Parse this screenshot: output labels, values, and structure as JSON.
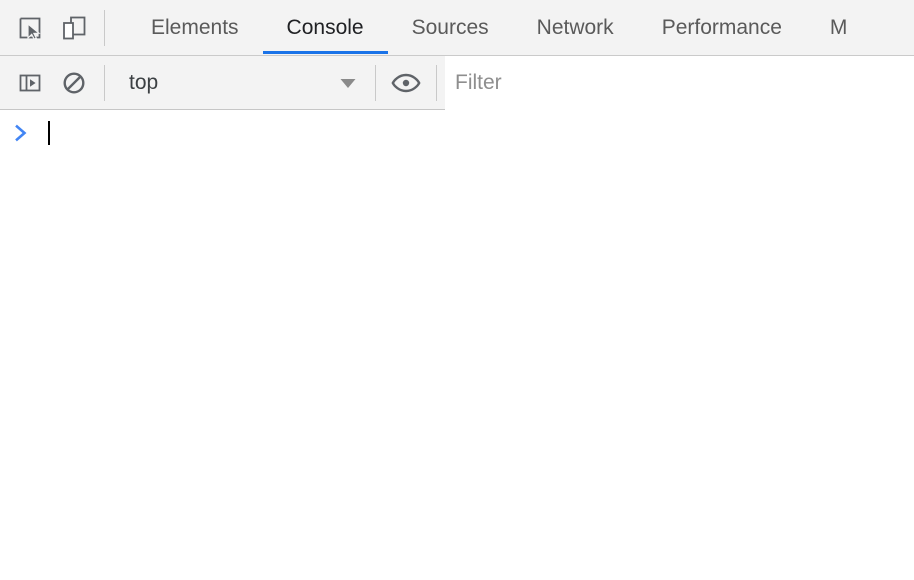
{
  "colors": {
    "accent": "#1a73e8",
    "toolbar_bg": "#f3f3f3",
    "body_bg": "#ffffff",
    "tab_text": "#5a5a5a",
    "tab_active_text": "#202124",
    "icon": "#5f6368",
    "prompt_arrow": "#4285f4",
    "caret": "#000000",
    "placeholder": "#8e8e8e"
  },
  "tabbar": {
    "inspect_button_title": "Inspect element",
    "device_button_title": "Toggle device toolbar",
    "tabs": [
      {
        "label": "Elements",
        "active": false
      },
      {
        "label": "Console",
        "active": true
      },
      {
        "label": "Sources",
        "active": false
      },
      {
        "label": "Network",
        "active": false
      },
      {
        "label": "Performance",
        "active": false
      },
      {
        "label": "M",
        "active": false
      }
    ]
  },
  "console_toolbar": {
    "sidebar_button_title": "Show console sidebar",
    "clear_button_title": "Clear console",
    "context": {
      "selected": "top",
      "options": [
        "top"
      ]
    },
    "eye_button_title": "Create live expression",
    "filter": {
      "value": "",
      "placeholder": "Filter"
    }
  },
  "console_body": {
    "prompt_symbol": ">",
    "input_value": "",
    "messages": []
  }
}
